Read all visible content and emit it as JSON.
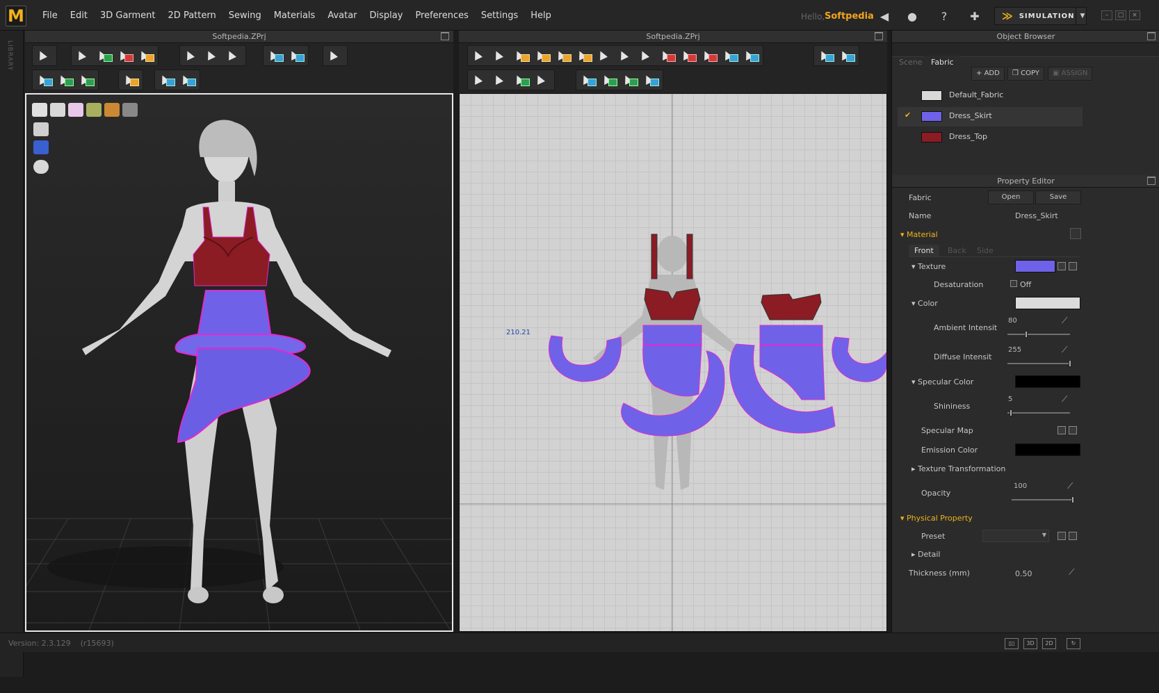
{
  "app": {
    "logo": "M",
    "hello": "Hello,",
    "user": "Softpedia",
    "mode": "SIMULATION",
    "version": "Version: 2.3.129",
    "build": "(r15693)",
    "library": "LIBRARY"
  },
  "menu": [
    "File",
    "Edit",
    "3D Garment",
    "2D Pattern",
    "Sewing",
    "Materials",
    "Avatar",
    "Display",
    "Preferences",
    "Settings",
    "Help"
  ],
  "panels": {
    "left_title": "Softpedia.ZPrj",
    "right_title": "Softpedia.ZPrj",
    "coord": "210.21"
  },
  "object_browser": {
    "title": "Object Browser",
    "tabs": [
      "Scene",
      "Fabric"
    ],
    "active_tab": "Fabric",
    "add": "ADD",
    "copy": "COPY",
    "assign": "ASSIGN",
    "fabrics": [
      {
        "name": "Default_Fabric",
        "color": "#d9d9d9"
      },
      {
        "name": "Dress_Skirt",
        "color": "#6f62e8",
        "selected": true
      },
      {
        "name": "Dress_Top",
        "color": "#8b1c24"
      }
    ]
  },
  "property_editor": {
    "title": "Property Editor",
    "fabric_label": "Fabric",
    "open": "Open",
    "save": "Save",
    "name_label": "Name",
    "name_value": "Dress_Skirt",
    "material": "Material",
    "mat_tabs": [
      "Front",
      "Back",
      "Side"
    ],
    "texture": "Texture",
    "desaturation": "Desaturation",
    "desat_value": "Off",
    "color": "Color",
    "color_swatch": "#dcdcdc",
    "ambient": "Ambient Intensit",
    "ambient_value": "80",
    "ambient_level": 0.3,
    "diffuse": "Diffuse Intensit",
    "diffuse_value": "255",
    "diffuse_level": 1,
    "specular_color": "Specular Color",
    "spec_swatch": "#000000",
    "shininess": "Shininess",
    "shininess_value": "5",
    "shininess_level": 0.05,
    "specular_map": "Specular Map",
    "emission": "Emission Color",
    "emission_swatch": "#000000",
    "texture_transform": "Texture Transformation",
    "opacity": "Opacity",
    "opacity_value": "100",
    "opacity_level": 1,
    "physical": "Physical Property",
    "preset": "Preset",
    "detail": "Detail",
    "thickness": "Thickness (mm)",
    "thickness_value": "0.50"
  },
  "colors": {
    "accent": "#f2b21b",
    "skirt": "#6f62e8",
    "top": "#8b1c24",
    "seam": "#e02ad0"
  }
}
